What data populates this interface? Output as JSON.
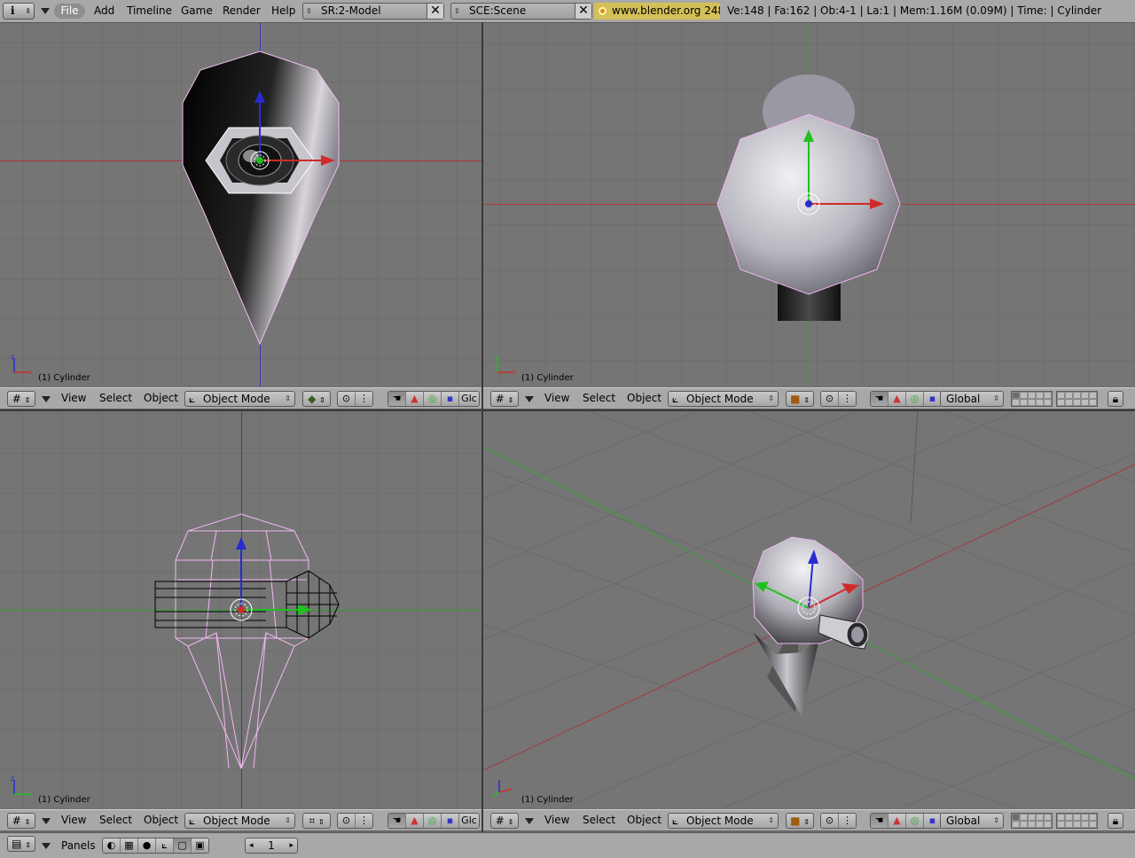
{
  "topbar": {
    "info_icon": "i",
    "menus": [
      "File",
      "Add",
      "Timeline",
      "Game",
      "Render",
      "Help"
    ],
    "screen_field": "SR:2-Model",
    "scene_field": "SCE:Scene",
    "url": "www.blender.org 248",
    "stats": "Ve:148 | Fa:162 | Ob:4-1 | La:1  | Mem:1.16M (0.09M)  | Time: | Cylinder"
  },
  "viewports": [
    {
      "name": "front",
      "object_label": "(1) Cylinder"
    },
    {
      "name": "top",
      "object_label": "(1) Cylinder"
    },
    {
      "name": "side",
      "object_label": "(1) Cylinder"
    },
    {
      "name": "perspective",
      "object_label": "(1) Cylinder"
    }
  ],
  "view_header": {
    "menu_view": "View",
    "menu_select": "Select",
    "menu_object": "Object",
    "mode": "Object Mode",
    "orientation_full": "Global",
    "orientation_cut": "Glc"
  },
  "buttons_window": {
    "panels_label": "Panels",
    "frame_value": "1"
  },
  "colors": {
    "header_bg": "#a8a8a8",
    "viewport_bg": "#757575",
    "grid_line": "#666666",
    "x_axis": "#c33232",
    "y_axis": "#35a535",
    "z_axis": "#3535c5",
    "selection_outline": "#f2b8f2",
    "url_bg": "#d4c058"
  }
}
